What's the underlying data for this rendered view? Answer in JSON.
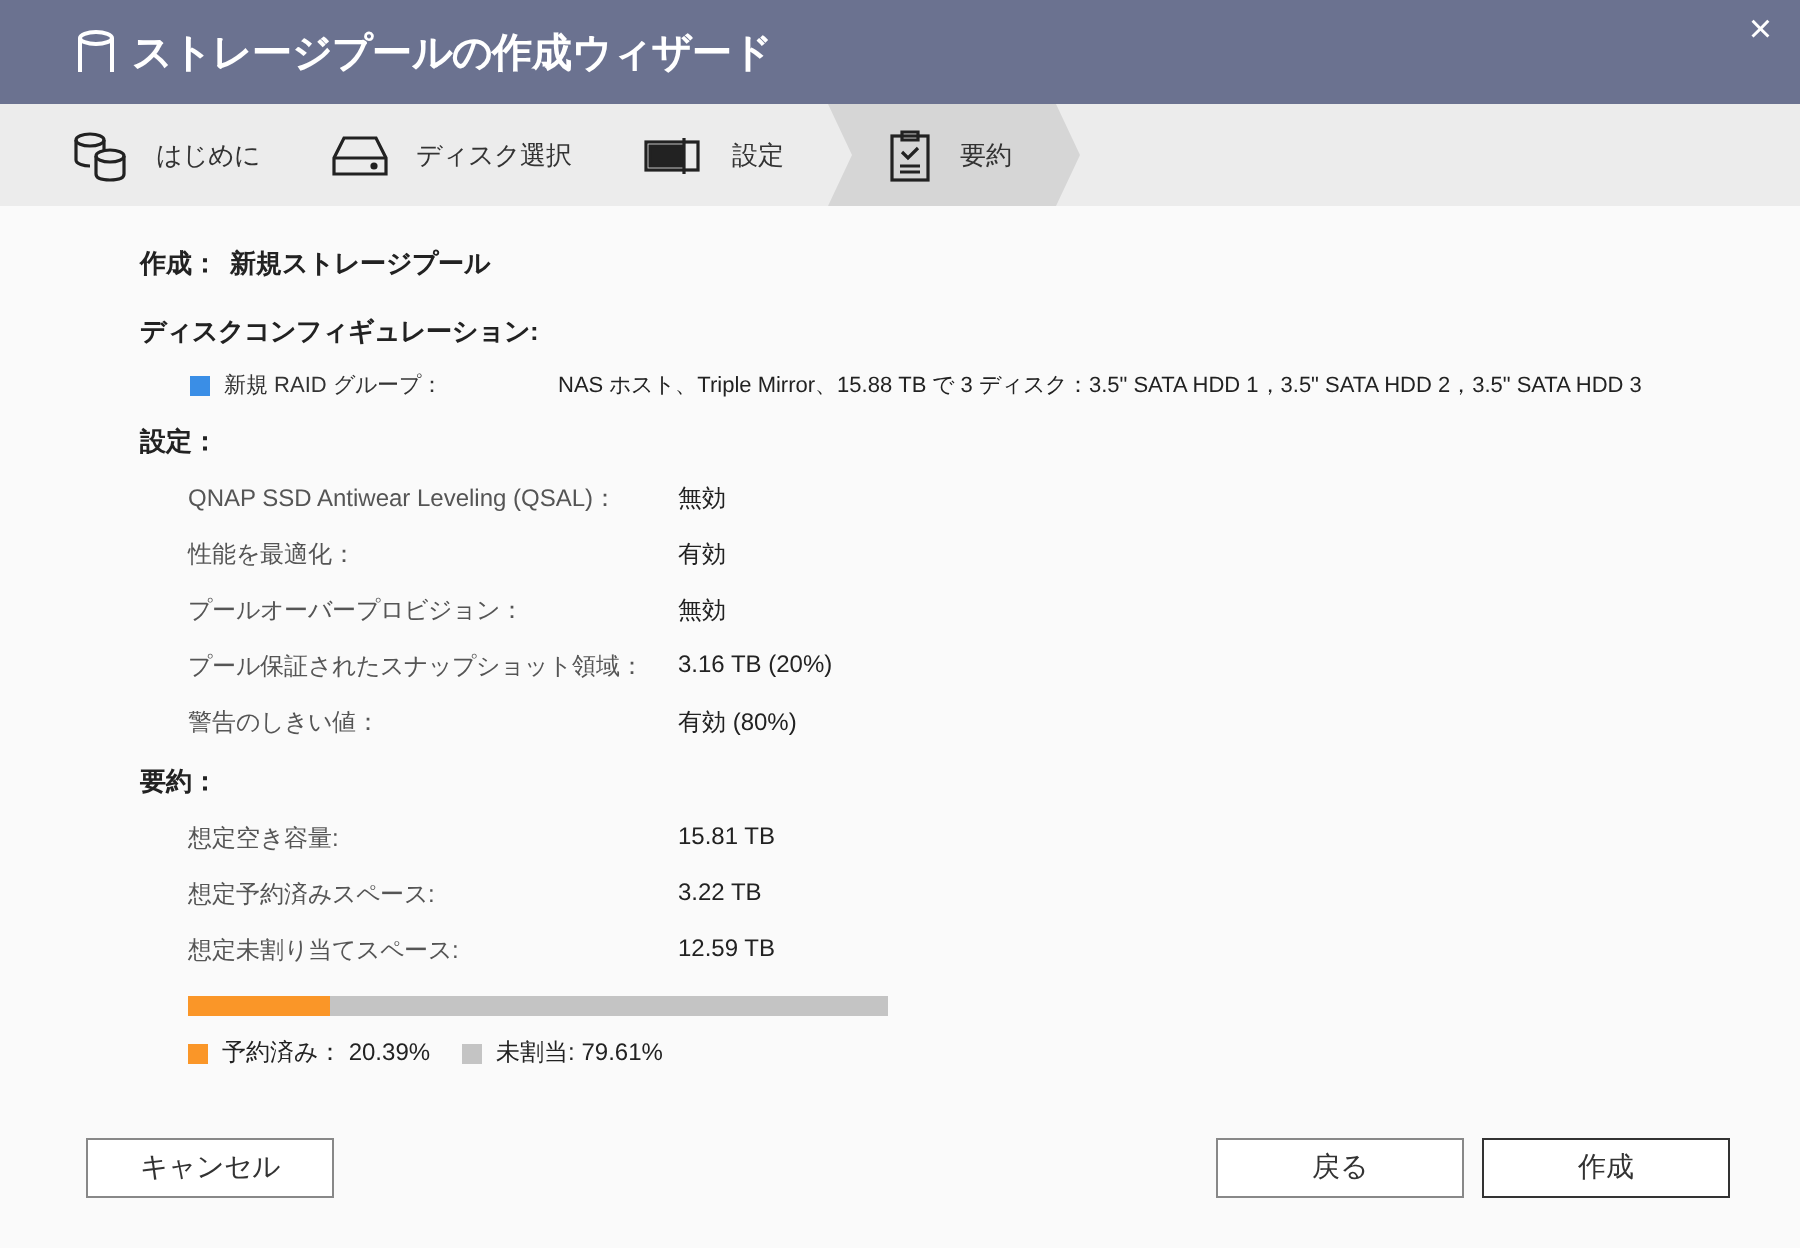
{
  "window": {
    "title": "ストレージプールの作成ウィザード",
    "close": "×"
  },
  "steps": [
    {
      "label": "はじめに",
      "selected": false
    },
    {
      "label": "ディスク選択",
      "selected": false
    },
    {
      "label": "設定",
      "selected": false
    },
    {
      "label": "要約",
      "selected": true
    }
  ],
  "create": {
    "label": "作成：",
    "value": "新規ストレージプール"
  },
  "disk_config": {
    "heading": "ディスクコンフィギュレーション:",
    "group": {
      "label": "新規 RAID グループ：",
      "value": "NAS ホスト、Triple Mirror、15.88 TB で 3 ディスク：3.5\" SATA HDD 1，3.5\" SATA HDD 2，3.5\" SATA HDD 3",
      "color": "#3a8ee6"
    }
  },
  "settings": {
    "heading": "設定：",
    "rows": [
      {
        "label": "QNAP SSD Antiwear Leveling (QSAL)：",
        "value": "無効"
      },
      {
        "label": "性能を最適化：",
        "value": "有効"
      },
      {
        "label": "プールオーバープロビジョン：",
        "value": "無効"
      },
      {
        "label": "プール保証されたスナップショット領域：",
        "value": "3.16 TB (20%)"
      },
      {
        "label": "警告のしきい値：",
        "value": "有効 (80%)"
      }
    ]
  },
  "summary": {
    "heading": "要約：",
    "rows": [
      {
        "label": "想定空き容量:",
        "value": "15.81 TB"
      },
      {
        "label": "想定予約済みスペース:",
        "value": "3.22 TB"
      },
      {
        "label": "想定未割り当てスペース:",
        "value": "12.59 TB"
      }
    ],
    "usage_bar": {
      "level": 0.2039
    },
    "legend": [
      {
        "label": "予約済み： 20.39%",
        "color": "#fa9628"
      },
      {
        "label": "未割当: 79.61%",
        "color": "#c4c4c4"
      }
    ]
  },
  "buttons": [
    {
      "label": "キャンセル",
      "kind": "cancel"
    },
    {
      "label": "戻る",
      "kind": "back"
    },
    {
      "label": "作成",
      "kind": "primary"
    }
  ]
}
